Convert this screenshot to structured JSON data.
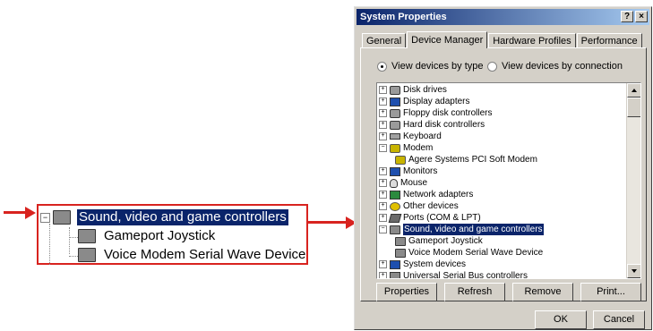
{
  "callout": {
    "items": [
      {
        "label": "Sound, video and game controllers",
        "icon": "sound-device-icon",
        "selected": true
      },
      {
        "label": "Gameport Joystick",
        "icon": "sound-device-icon"
      },
      {
        "label": "Voice Modem Serial Wave Device",
        "icon": "sound-device-icon"
      }
    ],
    "expander": "−"
  },
  "accent_color": "#d8231f",
  "dialog": {
    "title": "System Properties",
    "help_button": "?",
    "close_button": "×",
    "tabs": [
      "General",
      "Device Manager",
      "Hardware Profiles",
      "Performance"
    ],
    "active_tab": "Device Manager",
    "view_by_type": "View devices by type",
    "view_by_connection": "View devices by connection",
    "devices": [
      {
        "label": "Disk drives",
        "icon": "disk-icon",
        "expander": "+"
      },
      {
        "label": "Display adapters",
        "icon": "monitor-icon",
        "expander": "+"
      },
      {
        "label": "Floppy disk controllers",
        "icon": "disk-icon",
        "expander": "+"
      },
      {
        "label": "Hard disk controllers",
        "icon": "disk-icon",
        "expander": "+"
      },
      {
        "label": "Keyboard",
        "icon": "keyboard-icon",
        "expander": "+"
      },
      {
        "label": "Modem",
        "icon": "modem-icon",
        "expander": "−"
      },
      {
        "label": "Agere Systems PCI Soft Modem",
        "icon": "modem-icon",
        "expander": ""
      },
      {
        "label": "Monitors",
        "icon": "monitor-icon",
        "expander": "+"
      },
      {
        "label": "Mouse",
        "icon": "mouse-icon",
        "expander": "+"
      },
      {
        "label": "Network adapters",
        "icon": "network-icon",
        "expander": "+"
      },
      {
        "label": "Other devices",
        "icon": "question-icon",
        "expander": "+"
      },
      {
        "label": "Ports (COM & LPT)",
        "icon": "port-icon",
        "expander": "+"
      },
      {
        "label": "Sound, video and game controllers",
        "icon": "sound-device-icon",
        "expander": "−",
        "selected": true
      },
      {
        "label": "Gameport Joystick",
        "icon": "sound-device-icon",
        "expander": ""
      },
      {
        "label": "Voice Modem Serial Wave Device",
        "icon": "sound-device-icon",
        "expander": ""
      },
      {
        "label": "System devices",
        "icon": "computer-icon",
        "expander": "+"
      },
      {
        "label": "Universal Serial Bus controllers",
        "icon": "usb-icon",
        "expander": "+"
      }
    ],
    "buttons": {
      "properties": "Properties",
      "refresh": "Refresh",
      "remove": "Remove",
      "print": "Print...",
      "ok": "OK",
      "cancel": "Cancel"
    }
  }
}
